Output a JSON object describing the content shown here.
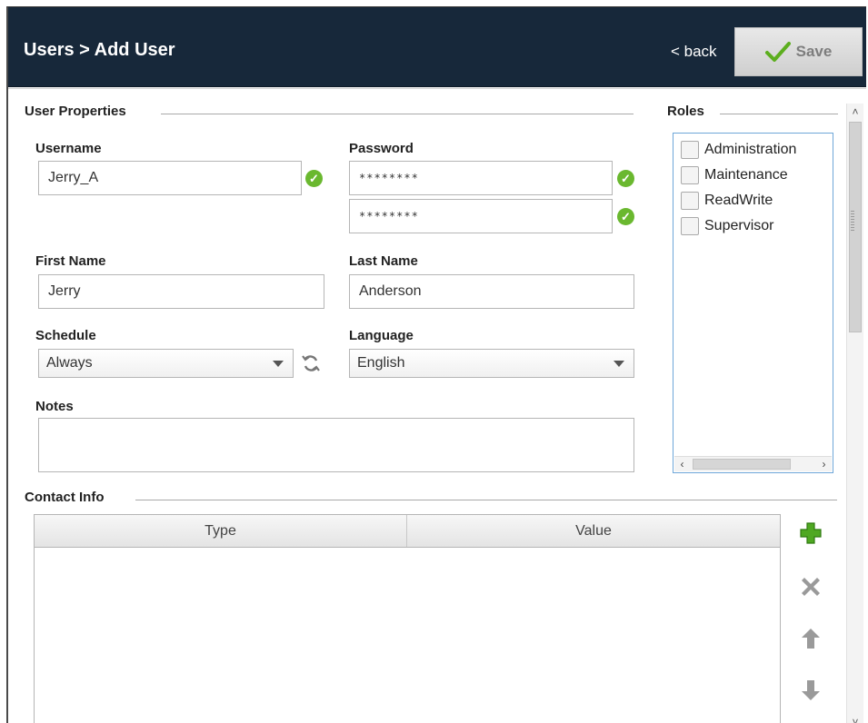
{
  "header": {
    "title": "Users > Add User",
    "back_label": "< back",
    "save_label": "Save"
  },
  "user_properties": {
    "legend": "User Properties",
    "username_label": "Username",
    "username_value": "Jerry_A",
    "password_label": "Password",
    "password_value": "********",
    "password_confirm_value": "********",
    "first_name_label": "First Name",
    "first_name_value": "Jerry",
    "last_name_label": "Last Name",
    "last_name_value": "Anderson",
    "schedule_label": "Schedule",
    "schedule_value": "Always",
    "language_label": "Language",
    "language_value": "English",
    "notes_label": "Notes",
    "notes_value": ""
  },
  "roles": {
    "legend": "Roles",
    "items": [
      {
        "label": "Administration",
        "checked": false
      },
      {
        "label": "Maintenance",
        "checked": false
      },
      {
        "label": "ReadWrite",
        "checked": false
      },
      {
        "label": "Supervisor",
        "checked": false
      }
    ]
  },
  "contact_info": {
    "legend": "Contact Info",
    "columns": [
      "Type",
      "Value"
    ],
    "rows": []
  },
  "colors": {
    "header_bg": "#17283a",
    "valid_check": "#6ab82f",
    "add_icon": "#4fa822",
    "roles_border": "#6ea6d8"
  }
}
